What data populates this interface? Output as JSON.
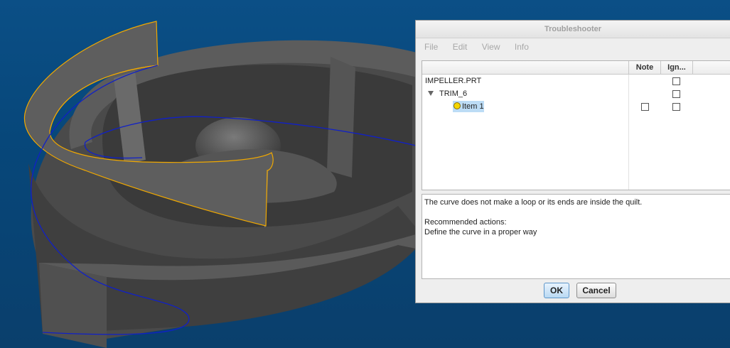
{
  "dialog": {
    "title": "Troubleshooter",
    "menu": [
      "File",
      "Edit",
      "View",
      "Info"
    ],
    "columns": {
      "note": "Note",
      "ignore": "Ign..."
    },
    "tree": [
      {
        "label": "IMPELLER.PRT",
        "has_note_checkbox": false,
        "ignore_checked": false
      },
      {
        "label": "TRIM_6",
        "expanded": true,
        "has_note_checkbox": false,
        "ignore_checked": false
      },
      {
        "label": "Item 1",
        "selected": true,
        "status_icon": "yellow-bulb-icon",
        "note_checked": false,
        "ignore_checked": false
      }
    ],
    "message": {
      "line1": "The curve does not make a loop or its ends are inside the quilt.",
      "line2": "Recommended actions:",
      "line3": "Define the curve in a proper way"
    },
    "buttons": {
      "ok": "OK",
      "cancel": "Cancel"
    }
  },
  "colors": {
    "background": "#0b4f86",
    "model": "#4d4d4d",
    "highlight_edges": "#f0a800",
    "curve": "#1020c8"
  }
}
